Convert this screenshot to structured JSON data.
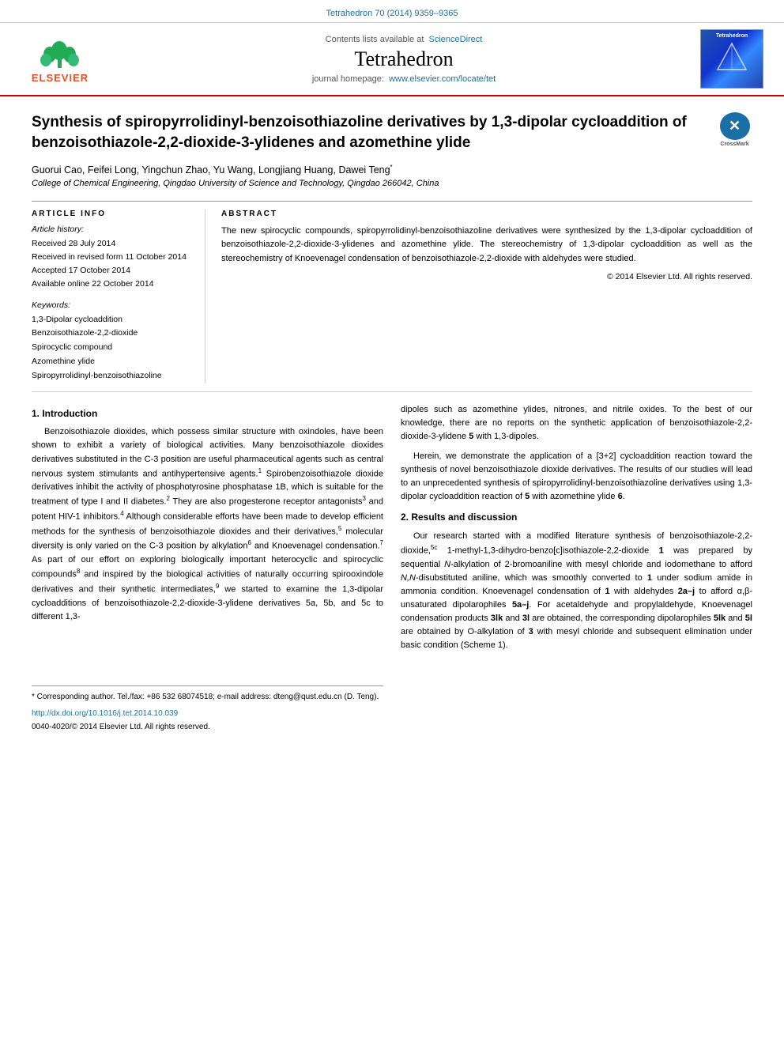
{
  "journal": {
    "doi_line": "Tetrahedron 70 (2014) 9359–9365",
    "sciencedirect_text": "Contents lists available at",
    "sciencedirect_link": "ScienceDirect",
    "name": "Tetrahedron",
    "homepage_text": "journal homepage:",
    "homepage_link": "www.elsevier.com/locate/tet",
    "elsevier_text": "ELSEVIER"
  },
  "article": {
    "title": "Synthesis of spiropyrrolidinyl-benzoisothiazoline derivatives by 1,3-dipolar cycloaddition of benzoisothiazole-2,2-dioxide-3-ylidenes and azomethine ylide",
    "authors": "Guorui Cao, Feifei Long, Yingchun Zhao, Yu Wang, Longjiang Huang, Dawei Teng",
    "author_asterisk": "*",
    "affiliation": "College of Chemical Engineering, Qingdao University of Science and Technology, Qingdao 266042, China"
  },
  "article_info": {
    "section_label": "ARTICLE INFO",
    "history_title": "Article history:",
    "received": "Received 28 July 2014",
    "revised": "Received in revised form 11 October 2014",
    "accepted": "Accepted 17 October 2014",
    "available": "Available online 22 October 2014",
    "keywords_title": "Keywords:",
    "keywords": [
      "1,3-Dipolar cycloaddition",
      "Benzoisothiazole-2,2-dioxide",
      "Spirocyclic compound",
      "Azomethine ylide",
      "Spiropyrrolidinyl-benzoisothiazoline"
    ]
  },
  "abstract": {
    "section_label": "ABSTRACT",
    "text": "The new spirocyclic compounds, spiropyrrolidinyl-benzoisothiazoline derivatives were synthesized by the 1,3-dipolar cycloaddition of benzoisothiazole-2,2-dioxide-3-ylidenes and azomethine ylide. The stereochemistry of 1,3-dipolar cycloaddition as well as the stereochemistry of Knoevenagel condensation of benzoisothiazole-2,2-dioxide with aldehydes were studied.",
    "copyright": "© 2014 Elsevier Ltd. All rights reserved."
  },
  "section1": {
    "heading": "1.  Introduction",
    "paragraph1": "Benzoisothiazole dioxides, which possess similar structure with oxindoles, have been shown to exhibit a variety of biological activities. Many benzoisothiazole dioxides derivatives substituted in the C-3 position are useful pharmaceutical agents such as central nervous system stimulants and antihypertensive agents.",
    "ref1": "1",
    "paragraph1b": " Spirobenzoisothiazole dioxide derivatives inhibit the activity of phosphotyrosine phosphatase 1B, which is suitable for the treatment of type I and II diabetes.",
    "ref2": "2",
    "paragraph1c": " They are also progesterone receptor antagonists",
    "ref3": "3",
    "paragraph1d": " and potent HIV-1 inhibitors.",
    "ref4": "4",
    "paragraph1e": " Although considerable efforts have been made to develop efficient methods for the synthesis of benzoisothiazole dioxides and their derivatives,",
    "ref5": "5",
    "paragraph1f": " molecular diversity is only varied on the C-3 position by alkylation",
    "ref6": "6",
    "paragraph1g": " and Knoevenagel condensation.",
    "ref7": "7",
    "paragraph1h": " As part of our effort on exploring biologically important heterocyclic and spirocyclic compounds",
    "ref8": "8",
    "paragraph1i": " and inspired by the biological activities of naturally occurring spirooxindole derivatives and their synthetic intermediates,",
    "ref9": "9",
    "paragraph1j": " we started to examine the 1,3-dipolar cycloadditions of benzoisothiazole-2,2-dioxide-3-ylidene derivatives 5a, 5b, and 5c to different 1,3-"
  },
  "section1_right": {
    "paragraph_cont": "dipoles such as azomethine ylides, nitrones, and nitrile oxides. To the best of our knowledge, there are no reports on the synthetic application of benzoisothiazole-2,2-dioxide-3-ylidene 5 with 1,3-dipoles.",
    "paragraph2": "Herein, we demonstrate the application of a [3+2] cycloaddition reaction toward the synthesis of novel benzoisothiazole dioxide derivatives. The results of our studies will lead to an unprecedented synthesis of spiropyrrolidinyl-benzoisothiazoline derivatives using 1,3-dipolar cycloaddition reaction of 5 with azomethine ylide 6.",
    "section2_heading": "2.  Results and discussion",
    "paragraph3": "Our research started with a modified literature synthesis of benzoisothiazole-2,2-dioxide,",
    "ref5c": "5c",
    "paragraph3b": " 1-methyl-1,3-dihydro-benzo[c]isothiazole-2,2-dioxide 1 was prepared by sequential N-alkylation of 2-bromoaniline with mesyl chloride and iodomethane to afford N,N-disubstituted aniline, which was smoothly converted to 1 under sodium amide in ammonia condition. Knoevenagel condensation of 1 with aldehydes 2a–j to afford α,β-unsaturated dipolarophiles 5a–j. For acetaldehyde and propylaldehyde, Knoevenagel condensation products 3lk and 3l are obtained, the corresponding dipolarophiles 5lk and 5l are obtained by O-alkylation of 3 with mesyl chloride and subsequent elimination under basic condition (Scheme 1).",
    "started_text": "started *"
  },
  "footnotes": {
    "asterisk_note": "* Corresponding author. Tel./fax: +86 532 68074518; e-mail address: dteng@qust.edu.cn (D. Teng).",
    "doi": "http://dx.doi.org/10.1016/j.tet.2014.10.039",
    "copyright": "0040-4020/© 2014 Elsevier Ltd. All rights reserved."
  },
  "crossmark": {
    "label": "CrossMark"
  }
}
